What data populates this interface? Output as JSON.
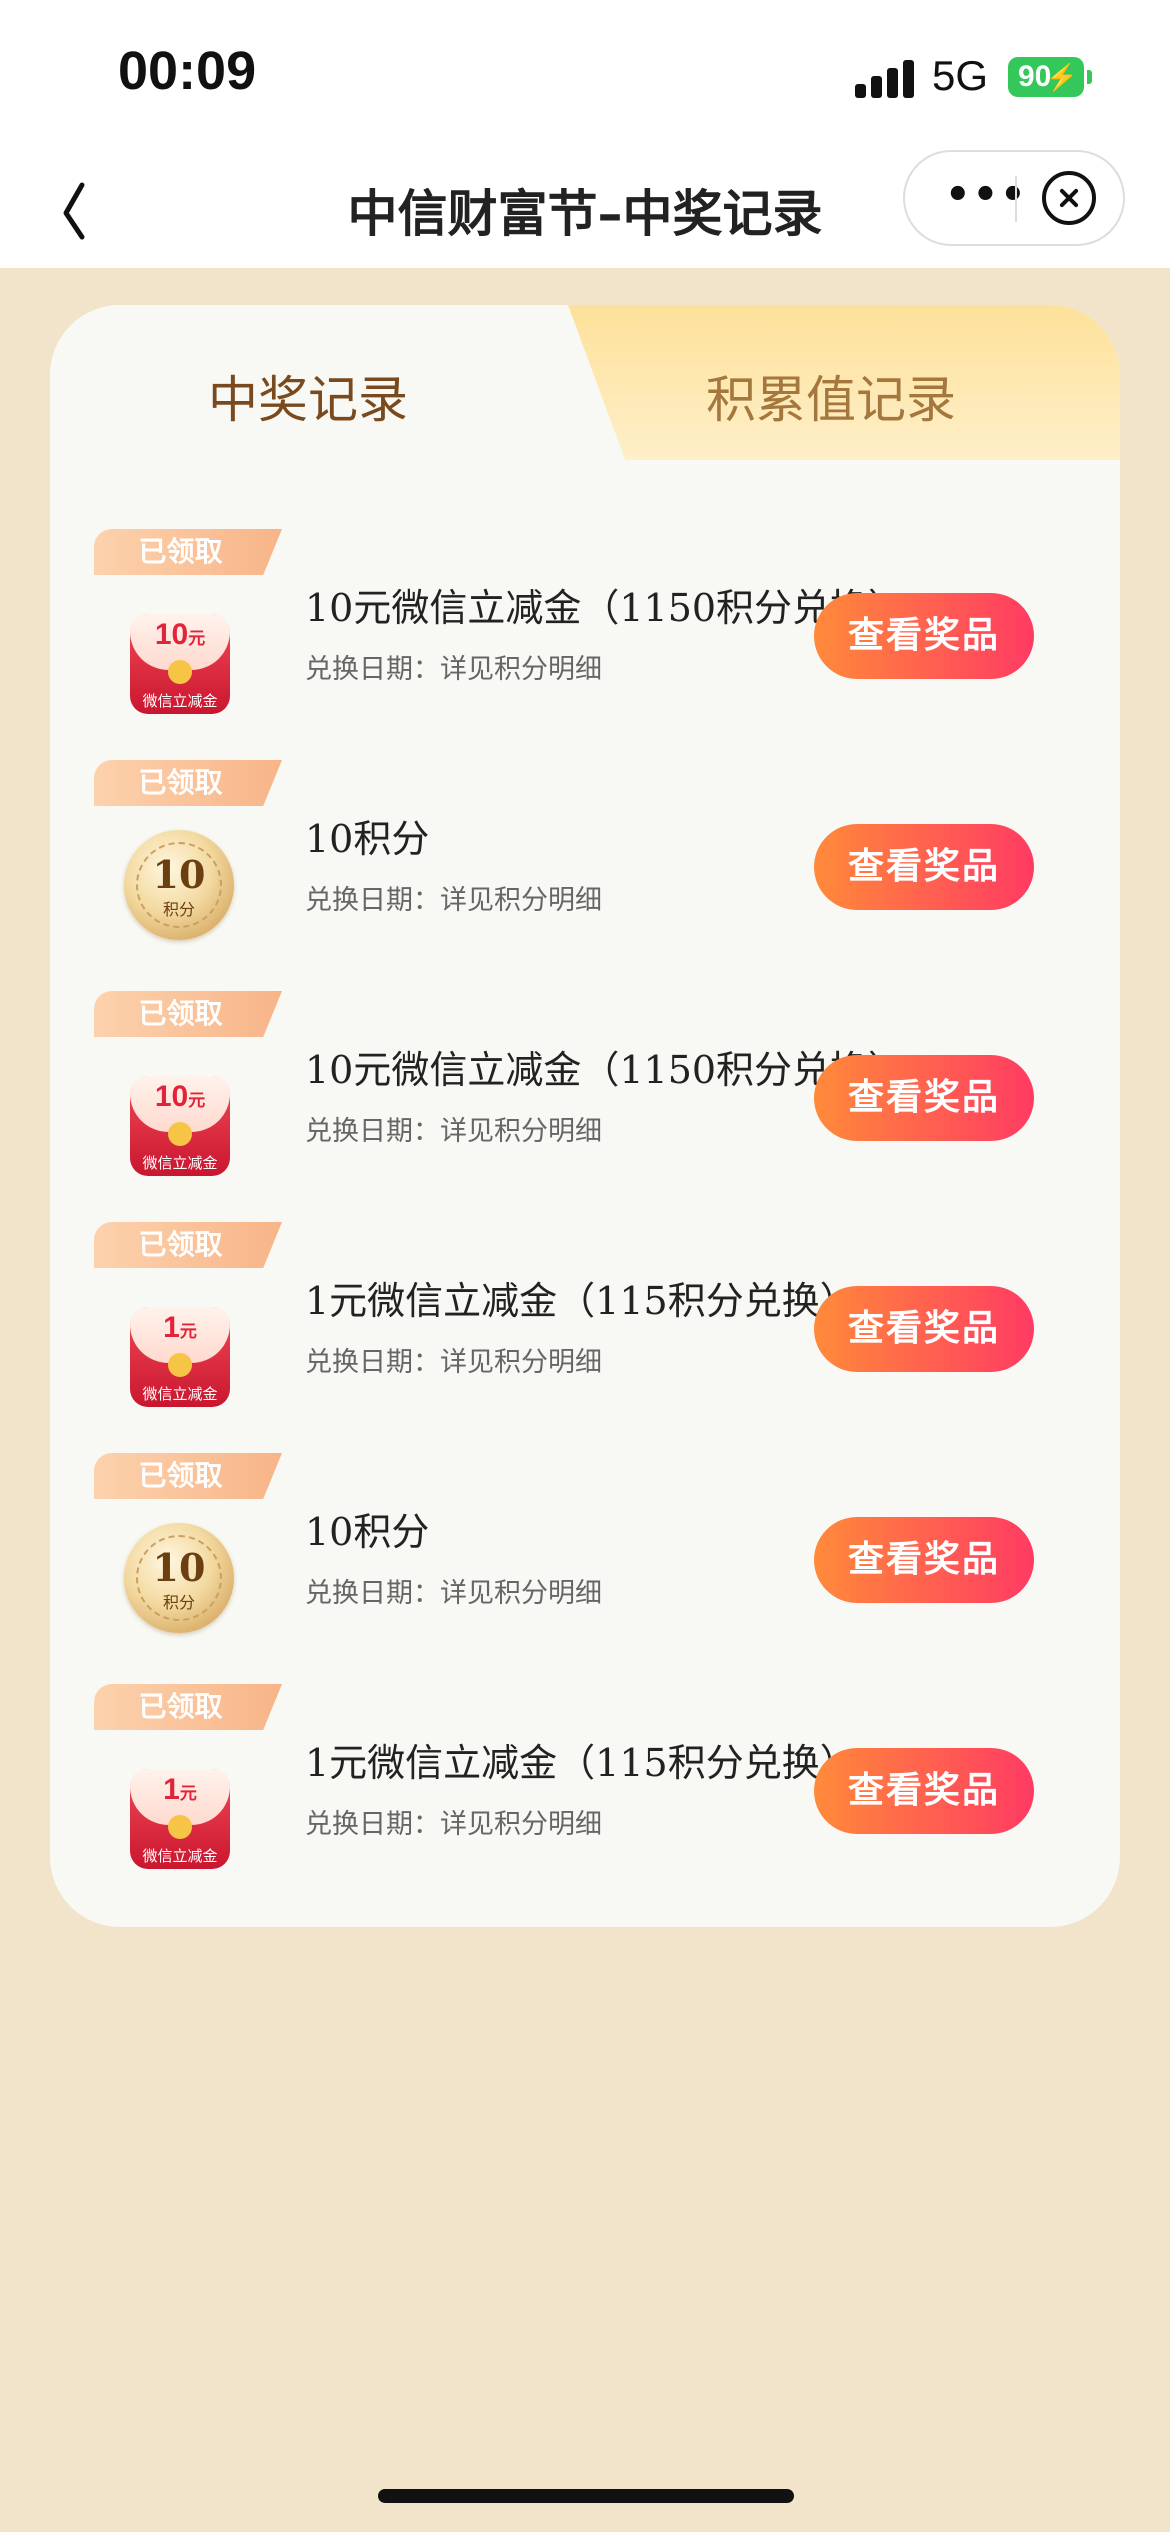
{
  "status_bar": {
    "time": "00:09",
    "network": "5G",
    "battery": "90"
  },
  "nav": {
    "title": "中信财富节–中奖记录"
  },
  "tabs": [
    {
      "label": "中奖记录",
      "active": true
    },
    {
      "label": "积累值记录",
      "active": false
    }
  ],
  "records": [
    {
      "status": "已领取",
      "title": "10元微信立减金（1150积分兑换）",
      "subtitle": "兑换日期：详见积分明细",
      "button": "查看奖品",
      "icon": "red-envelope-icon",
      "icon_amount": "10",
      "icon_unit": "元",
      "icon_label": "微信立减金"
    },
    {
      "status": "已领取",
      "title": "10积分",
      "subtitle": "兑换日期：详见积分明细",
      "button": "查看奖品",
      "icon": "points-coin-icon",
      "icon_amount": "10",
      "icon_label": "积分"
    },
    {
      "status": "已领取",
      "title": "10元微信立减金（1150积分兑换）",
      "subtitle": "兑换日期：详见积分明细",
      "button": "查看奖品",
      "icon": "red-envelope-icon",
      "icon_amount": "10",
      "icon_unit": "元",
      "icon_label": "微信立减金"
    },
    {
      "status": "已领取",
      "title": "1元微信立减金（115积分兑换）",
      "subtitle": "兑换日期：详见积分明细",
      "button": "查看奖品",
      "icon": "red-envelope-icon",
      "icon_amount": "1",
      "icon_unit": "元",
      "icon_label": "微信立减金"
    },
    {
      "status": "已领取",
      "title": "10积分",
      "subtitle": "兑换日期：详见积分明细",
      "button": "查看奖品",
      "icon": "points-coin-icon",
      "icon_amount": "10",
      "icon_label": "积分"
    },
    {
      "status": "已领取",
      "title": "1元微信立减金（115积分兑换）",
      "subtitle": "兑换日期：详见积分明细",
      "button": "查看奖品",
      "icon": "red-envelope-icon",
      "icon_amount": "1",
      "icon_unit": "元",
      "icon_label": "微信立减金"
    }
  ],
  "colors": {
    "page_bg": "#f2e4cb",
    "button_start": "#ff8a3a",
    "button_end": "#ff3b63",
    "tab_active_text": "#7a4a1e"
  }
}
